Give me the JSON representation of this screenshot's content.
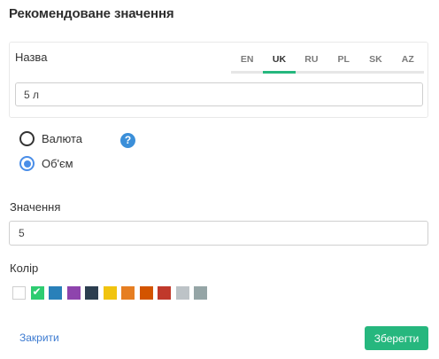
{
  "dialog": {
    "title": "Рекомендоване значення"
  },
  "name_field": {
    "label": "Назва",
    "value": "5 л",
    "languages": [
      "EN",
      "UK",
      "RU",
      "PL",
      "SK",
      "AZ"
    ],
    "active_language": "UK"
  },
  "type_options": {
    "items": [
      {
        "label": "Валюта",
        "checked": false
      },
      {
        "label": "Об'єм",
        "checked": true
      }
    ],
    "help_icon": "question-circle-icon"
  },
  "value_field": {
    "label": "Значення",
    "value": "5"
  },
  "color_field": {
    "label": "Колір",
    "selected": "#2ecc71",
    "colors": [
      "#ffffff",
      "#2ecc71",
      "#2980b9",
      "#8e44ad",
      "#2c3e50",
      "#f1c40f",
      "#e67e22",
      "#d35400",
      "#c0392b",
      "#bdc3c7",
      "#95a5a6"
    ]
  },
  "actions": {
    "close_label": "Закрити",
    "save_label": "Зберегти"
  },
  "theme": {
    "accent": "#26b77e",
    "link": "#3d7bd1",
    "radio": "#4a8ee8"
  }
}
